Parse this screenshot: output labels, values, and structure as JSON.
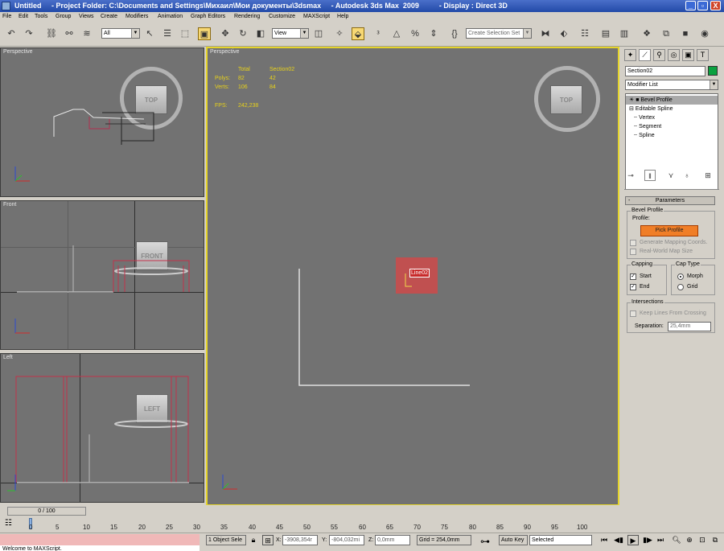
{
  "window": {
    "title": "Untitled     - Project Folder: C:\\Documents and Settings\\Михаил\\Мои документы\\3dsmax     - Autodesk 3ds Max  2009          - Display : Direct 3D",
    "minimize": "_",
    "maximize": "▫",
    "close": "X"
  },
  "menu": [
    "File",
    "Edit",
    "Tools",
    "Group",
    "Views",
    "Create",
    "Modifiers",
    "Animation",
    "Graph Editors",
    "Rendering",
    "Customize",
    "MAXScript",
    "Help"
  ],
  "toolbar": {
    "selection_filter": "All",
    "reference_coord": "View",
    "named_selection_placeholder": "Create Selection Set"
  },
  "viewports": {
    "perspective_top_left": {
      "label": "Perspective",
      "cube_label": "TOP"
    },
    "front": {
      "label": "Front",
      "cube_label": "FRONT"
    },
    "left": {
      "label": "Left",
      "cube_label": "LEFT"
    },
    "perspective_main": {
      "label": "Perspective",
      "cube_label": "TOP",
      "object_label": "Line02",
      "stats": {
        "col_total": "Total",
        "col_selection": "Section02",
        "polys_label": "Polys:",
        "polys_total": "82",
        "polys_selection": "42",
        "verts_label": "Verts:",
        "verts_total": "106",
        "verts_selection": "84",
        "fps_label": "FPS:",
        "fps_value": "242,238"
      }
    }
  },
  "command_panel": {
    "object_name": "Section02",
    "object_color": "#0aa140",
    "modifier_list": "Modifier List",
    "stack": {
      "bevel_profile": "Bevel Profile",
      "editable_spline": "Editable Spline",
      "vertex": "Vertex",
      "segment": "Segment",
      "spline": "Spline"
    },
    "parameters": {
      "rollout_title": "Parameters",
      "collapse": "-",
      "bevel_profile_group": "Bevel Profile",
      "profile_label": "Profile:",
      "pick_profile": "Pick Profile",
      "generate_mapping": "Generate Mapping Coords.",
      "real_world_map": "Real-World Map Size",
      "capping_group": "Capping",
      "start": "Start",
      "end": "End",
      "cap_type_group": "Cap Type",
      "morph": "Morph",
      "grid": "Grid",
      "intersections_group": "Intersections",
      "keep_lines": "Keep Lines From Crossing",
      "separation_label": "Separation:",
      "separation_value": "25,4mm"
    }
  },
  "timeline": {
    "slider": "0 / 100",
    "ticks": [
      "0",
      "5",
      "10",
      "15",
      "20",
      "25",
      "30",
      "35",
      "40",
      "45",
      "50",
      "55",
      "60",
      "65",
      "70",
      "75",
      "80",
      "85",
      "90",
      "95",
      "100"
    ]
  },
  "status": {
    "selected_count": "1 Object Sele",
    "x_label": "X:",
    "x_value": "-3908,354r",
    "y_label": "Y:",
    "y_value": "-804,032mi",
    "z_label": "Z:",
    "z_value": "0,0mm",
    "grid": "Grid = 254,0mm",
    "auto_key": "Auto Key",
    "key_mode": "Selected",
    "maxscript_listener": "Welcome to MAXScript."
  }
}
